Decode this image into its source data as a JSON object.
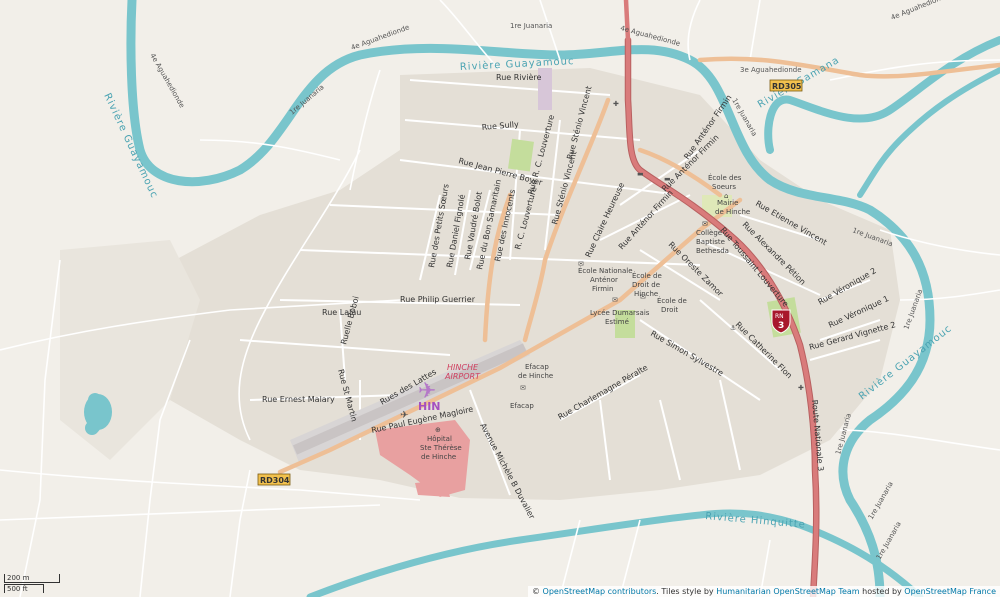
{
  "rivers": {
    "guayamouc_north": "Rivière Guayamouc",
    "guayamouc_west": "Rivière Guayamouc",
    "guayamouc_east": "Rivière Guayamouc",
    "samana": "Rivière Samana",
    "hinquitte": "Rivière Hinquitte"
  },
  "minor_roads": {
    "aguahedionde_1": "4e Aguahedionde",
    "aguahedionde_2": "4e Aguahedionde",
    "aguahedionde_3": "4e Aguahedionde",
    "aguahedionde_4": "3e Aguahedionde",
    "aguahedionde_5": "4e Aguahedionde",
    "juanaria_1": "1re Juanaria",
    "juanaria_2": "1re Juanaria",
    "juanaria_3": "1re Juanaria",
    "juanaria_4": "1re Juanaria",
    "juanaria_5": "1re Juanaria",
    "juanaria_6": "1re Juanaria",
    "juanaria_7": "1re Juanaria",
    "juanaria_8": "1re Juanaria"
  },
  "streets": {
    "riviere": "Rue Rivière",
    "sully": "Rue Sully",
    "jean_pierre_boyer": "Rue Jean Pierre Boyer",
    "louverture_1": "Rue R. C. Louverture",
    "louverture_2": "R. C. Louverture",
    "stenio_vincent": "Rue Sténio Vincent",
    "stenio_vincent_2": "Rue Sténio Vincent",
    "antenor_firmin_1": "Rue Anténor Firmin",
    "antenor_firmin_2": "Rue Anténor Firmin",
    "antenor_firmin_3": "Rue Anténor Firmin",
    "petits_soeurs": "Rue des Petits Sœurs",
    "daniel_fignole": "Rue Daniel Fignolé",
    "vaudre_bolot": "Rue Vaudré Bolot",
    "du_bon_samaritain": "Rue du Bon Samaritain",
    "des_innocents": "Rue des Innocents",
    "claire_heureuse": "Rue Claire Heureuse",
    "oreste_zamor": "Rue Oreste Zamor",
    "philip_guerrier": "Rue Philip Guerrier",
    "lalau": "Rue Lalau",
    "boboi": "Ruelle Boboi",
    "st_martin": "Rue St Martin",
    "ernest_malary": "Rue Ernest Malary",
    "lattes": "Rues des Lattes",
    "paul_eugene": "Rue Paul Eugène Magloire",
    "maurice_duvalier": "Avenue Michèle B Duvalier",
    "charlemagne": "Rue Charlemagne Péralte",
    "simon_sylvestre": "Rue Simon Sylvestre",
    "catherine_flon": "Rue Catherine Flon",
    "etienne_vincent": "Rue Etienne Vincent",
    "alexandre_petion": "Rue Alexandre Pétion",
    "veronique_1": "Rue Véronique 1",
    "veronique_2": "Rue Véronique 2",
    "gerard_vignette": "Rue Gerard Vignette 2",
    "toussaint": "Rue Toussaint Louverture",
    "route_nat": "Route Nationale 3"
  },
  "pois": {
    "ecole_soeurs": [
      "École des",
      "Soeurs"
    ],
    "mairie": [
      "Mairie",
      "de Hinche"
    ],
    "college": [
      "Collège",
      "Baptiste",
      "Bethesda"
    ],
    "ecole_nationale": [
      "École Nationale",
      "Anténor",
      "Firmin"
    ],
    "ecole_droit_1": [
      "École de",
      "Droit de",
      "Hinche"
    ],
    "ecole_droit_2": [
      "École de",
      "Droit"
    ],
    "lycee": [
      "Lycée Dumarsais",
      "Estimé"
    ],
    "efacap_1": [
      "Efacap",
      "de Hinche"
    ],
    "efacap_2": "Efacap",
    "hopital": [
      "Hôpital",
      "Ste Thérèse",
      "de Hinche"
    ]
  },
  "airport": {
    "name": [
      "HINCHE",
      "AIRPORT"
    ],
    "code": "HIN"
  },
  "shields": {
    "rd305": "RD305",
    "rd304": "RD304",
    "rn3_top": "RN",
    "rn3_bottom": "3"
  },
  "scale": {
    "metric": "200 m",
    "imperial": "500 ft"
  },
  "attribution": {
    "copyright": "©",
    "osm": "OpenStreetMap contributors",
    "tiles_by": ". Tiles style by",
    "hot": "Humanitarian OpenStreetMap Team",
    "hosted_by": "hosted by",
    "osm_fr": "OpenStreetMap France"
  },
  "colors": {
    "water": "#79c5cc",
    "land": "#f2efe9",
    "urban": "#e2ddd3",
    "major_road": "#d97b7b",
    "secondary_road": "#eebf96",
    "hospital": "#e8a0a0",
    "airport": "#b478c8",
    "park": "#c4dd9c"
  }
}
